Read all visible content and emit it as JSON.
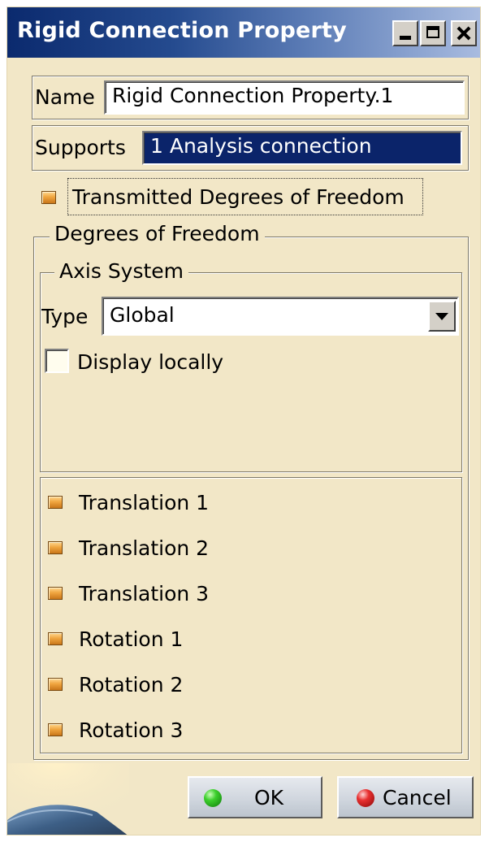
{
  "window": {
    "title": "Rigid Connection Property",
    "controls": [
      "minimize-icon",
      "maximize-icon",
      "close-icon"
    ]
  },
  "name_row": {
    "label": "Name",
    "value": "Rigid Connection Property.1"
  },
  "supports_row": {
    "label": "Supports",
    "value": "1 Analysis connection"
  },
  "transmitted_dof": {
    "label": "Transmitted Degrees of Freedom"
  },
  "dof_group": {
    "legend": "Degrees of Freedom",
    "axis_system": {
      "legend": "Axis System",
      "type_label": "Type",
      "type_value": "Global",
      "display_locally_label": "Display locally",
      "display_locally_checked": false
    },
    "items": [
      {
        "label": "Translation 1"
      },
      {
        "label": "Translation 2"
      },
      {
        "label": "Translation 3"
      },
      {
        "label": "Rotation 1"
      },
      {
        "label": "Rotation 2"
      },
      {
        "label": "Rotation 3"
      }
    ]
  },
  "buttons": {
    "ok": "OK",
    "cancel": "Cancel"
  },
  "colors": {
    "dialog_bg": "#f2e7c7",
    "selection": "#0b246a",
    "title_start": "#0b2a6e",
    "title_end": "#a9bce0",
    "dof_icon": "#f0a640"
  }
}
